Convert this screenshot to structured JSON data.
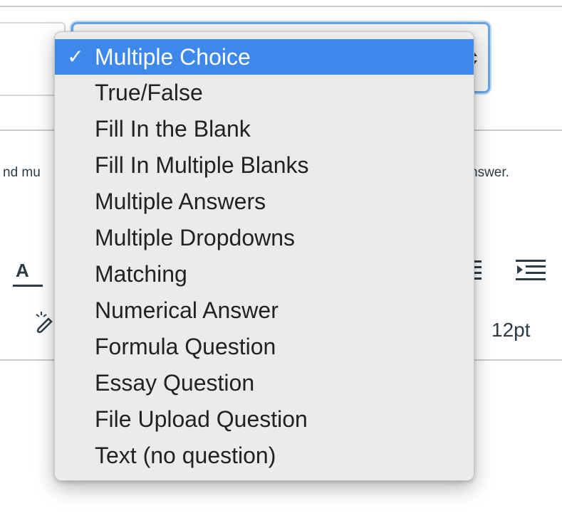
{
  "question_type_select": {
    "selected_value": "Multiple Choice",
    "options": [
      {
        "label": "Multiple Choice",
        "selected": true
      },
      {
        "label": "True/False",
        "selected": false
      },
      {
        "label": "Fill In the Blank",
        "selected": false
      },
      {
        "label": "Fill In Multiple Blanks",
        "selected": false
      },
      {
        "label": "Multiple Answers",
        "selected": false
      },
      {
        "label": "Multiple Dropdowns",
        "selected": false
      },
      {
        "label": "Matching",
        "selected": false
      },
      {
        "label": "Numerical Answer",
        "selected": false
      },
      {
        "label": "Formula Question",
        "selected": false
      },
      {
        "label": "Essay Question",
        "selected": false
      },
      {
        "label": "File Upload Question",
        "selected": false
      },
      {
        "label": "Text (no question)",
        "selected": false
      }
    ],
    "check_glyph": "✓"
  },
  "background": {
    "instruction_left_fragment": "nd mu",
    "instruction_right_fragment": "nswer.",
    "toolbar": {
      "text_color_label": "A",
      "font_size_label": "12pt",
      "icons": [
        "text-color-icon",
        "magic-wand-icon",
        "list-icon",
        "indent-icon"
      ]
    }
  },
  "colors": {
    "selection_highlight": "#3e88ec",
    "focus_ring": "#6aa5e9",
    "menu_background": "#ebebeb"
  }
}
